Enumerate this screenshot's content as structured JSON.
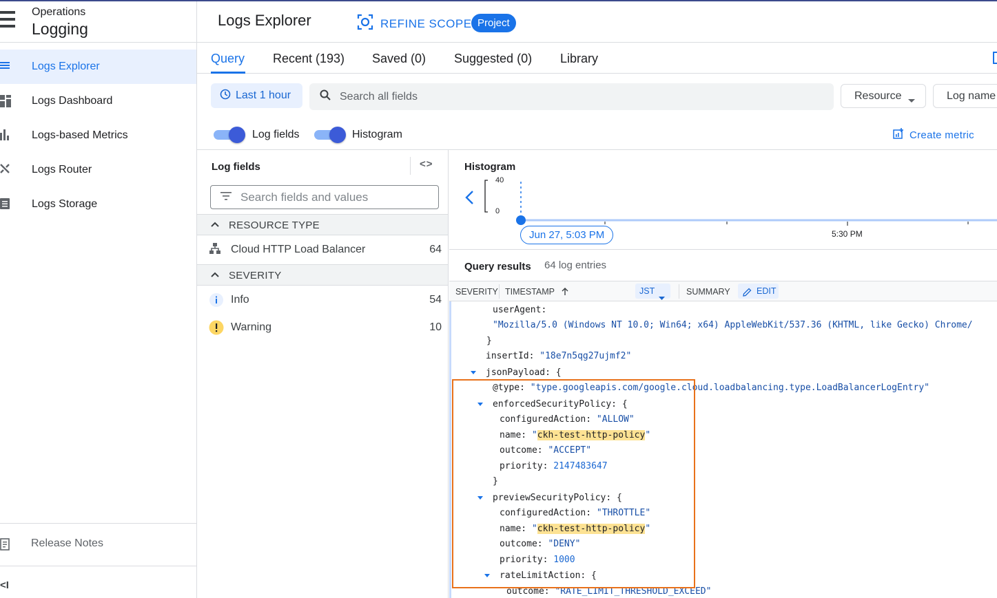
{
  "sidebar": {
    "product": "Operations",
    "title": "Logging",
    "items": [
      {
        "label": "Logs Explorer",
        "icon": "list-icon"
      },
      {
        "label": "Logs Dashboard",
        "icon": "dashboard-icon"
      },
      {
        "label": "Logs-based Metrics",
        "icon": "bar-chart-icon"
      },
      {
        "label": "Logs Router",
        "icon": "router-icon"
      },
      {
        "label": "Logs Storage",
        "icon": "storage-icon"
      }
    ],
    "release_notes": "Release Notes",
    "collapse": "<I"
  },
  "header": {
    "title": "Logs Explorer",
    "refine_scope": "REFINE SCOPE",
    "scope_badge": "Project"
  },
  "tabs": [
    {
      "label": "Query",
      "active": true
    },
    {
      "label": "Recent (193)"
    },
    {
      "label": "Saved (0)"
    },
    {
      "label": "Suggested (0)"
    },
    {
      "label": "Library"
    }
  ],
  "query_bar": {
    "time_range": "Last 1 hour",
    "search_placeholder": "Search all fields",
    "resource_label": "Resource",
    "log_name_label": "Log name"
  },
  "toggles": {
    "log_fields": {
      "label": "Log fields",
      "on": true
    },
    "histogram": {
      "label": "Histogram",
      "on": true
    },
    "create_metric": "Create metric"
  },
  "log_fields": {
    "title": "Log fields",
    "expand": "<>",
    "search_placeholder": "Search fields and values",
    "sections": [
      {
        "title": "RESOURCE TYPE",
        "rows": [
          {
            "label": "Cloud HTTP Load Balancer",
            "count": "64"
          }
        ]
      },
      {
        "title": "SEVERITY",
        "rows": [
          {
            "label": "Info",
            "count": "54"
          },
          {
            "label": "Warning",
            "count": "10"
          }
        ]
      }
    ]
  },
  "histogram": {
    "title": "Histogram",
    "y_max": "40",
    "y_min": "0",
    "current_time": "Jun 27, 5:03 PM",
    "x_label": "5:30 PM"
  },
  "results": {
    "title": "Query results",
    "count": "64 log entries",
    "columns": {
      "severity": "SEVERITY",
      "timestamp": "TIMESTAMP",
      "tz": "JST",
      "summary": "SUMMARY",
      "edit": "EDIT"
    }
  },
  "log_entry": {
    "userAgent_key": "userAgent:",
    "userAgent_value": "\"Mozilla/5.0 (Windows NT 10.0; Win64; x64) AppleWebKit/537.36 (KHTML, like Gecko) Chrome/",
    "close1": "}",
    "insertId_key": "insertId:",
    "insertId_value": "\"18e7n5qg27ujmf2\"",
    "jsonPayload_key": "jsonPayload: {",
    "type_key": "@type:",
    "type_value": "\"type.googleapis.com/google.cloud.loadbalancing.type.LoadBalancerLogEntry\"",
    "enforced_key": "enforcedSecurityPolicy: {",
    "enforced": {
      "configuredAction_key": "configuredAction:",
      "configuredAction": "\"ALLOW\"",
      "name_key": "name:",
      "name": "ckh-test-http-policy",
      "outcome_key": "outcome:",
      "outcome": "\"ACCEPT\"",
      "priority_key": "priority:",
      "priority": "2147483647"
    },
    "close2": "}",
    "preview_key": "previewSecurityPolicy: {",
    "preview": {
      "configuredAction_key": "configuredAction:",
      "configuredAction": "\"THROTTLE\"",
      "name_key": "name:",
      "name": "ckh-test-http-policy",
      "outcome_key": "outcome:",
      "outcome": "\"DENY\"",
      "priority_key": "priority:",
      "priority": "1000"
    },
    "rateLimit_key": "rateLimitAction: {",
    "rateLimit_outcome_key": "outcome:",
    "rateLimit_outcome": "\"RATE_LIMIT_THRESHOLD_EXCEED\"",
    "quote": "\""
  },
  "colors": {
    "accent": "#1a73e8",
    "highlight_box": "#e8711a",
    "highlight": "#fde293"
  }
}
